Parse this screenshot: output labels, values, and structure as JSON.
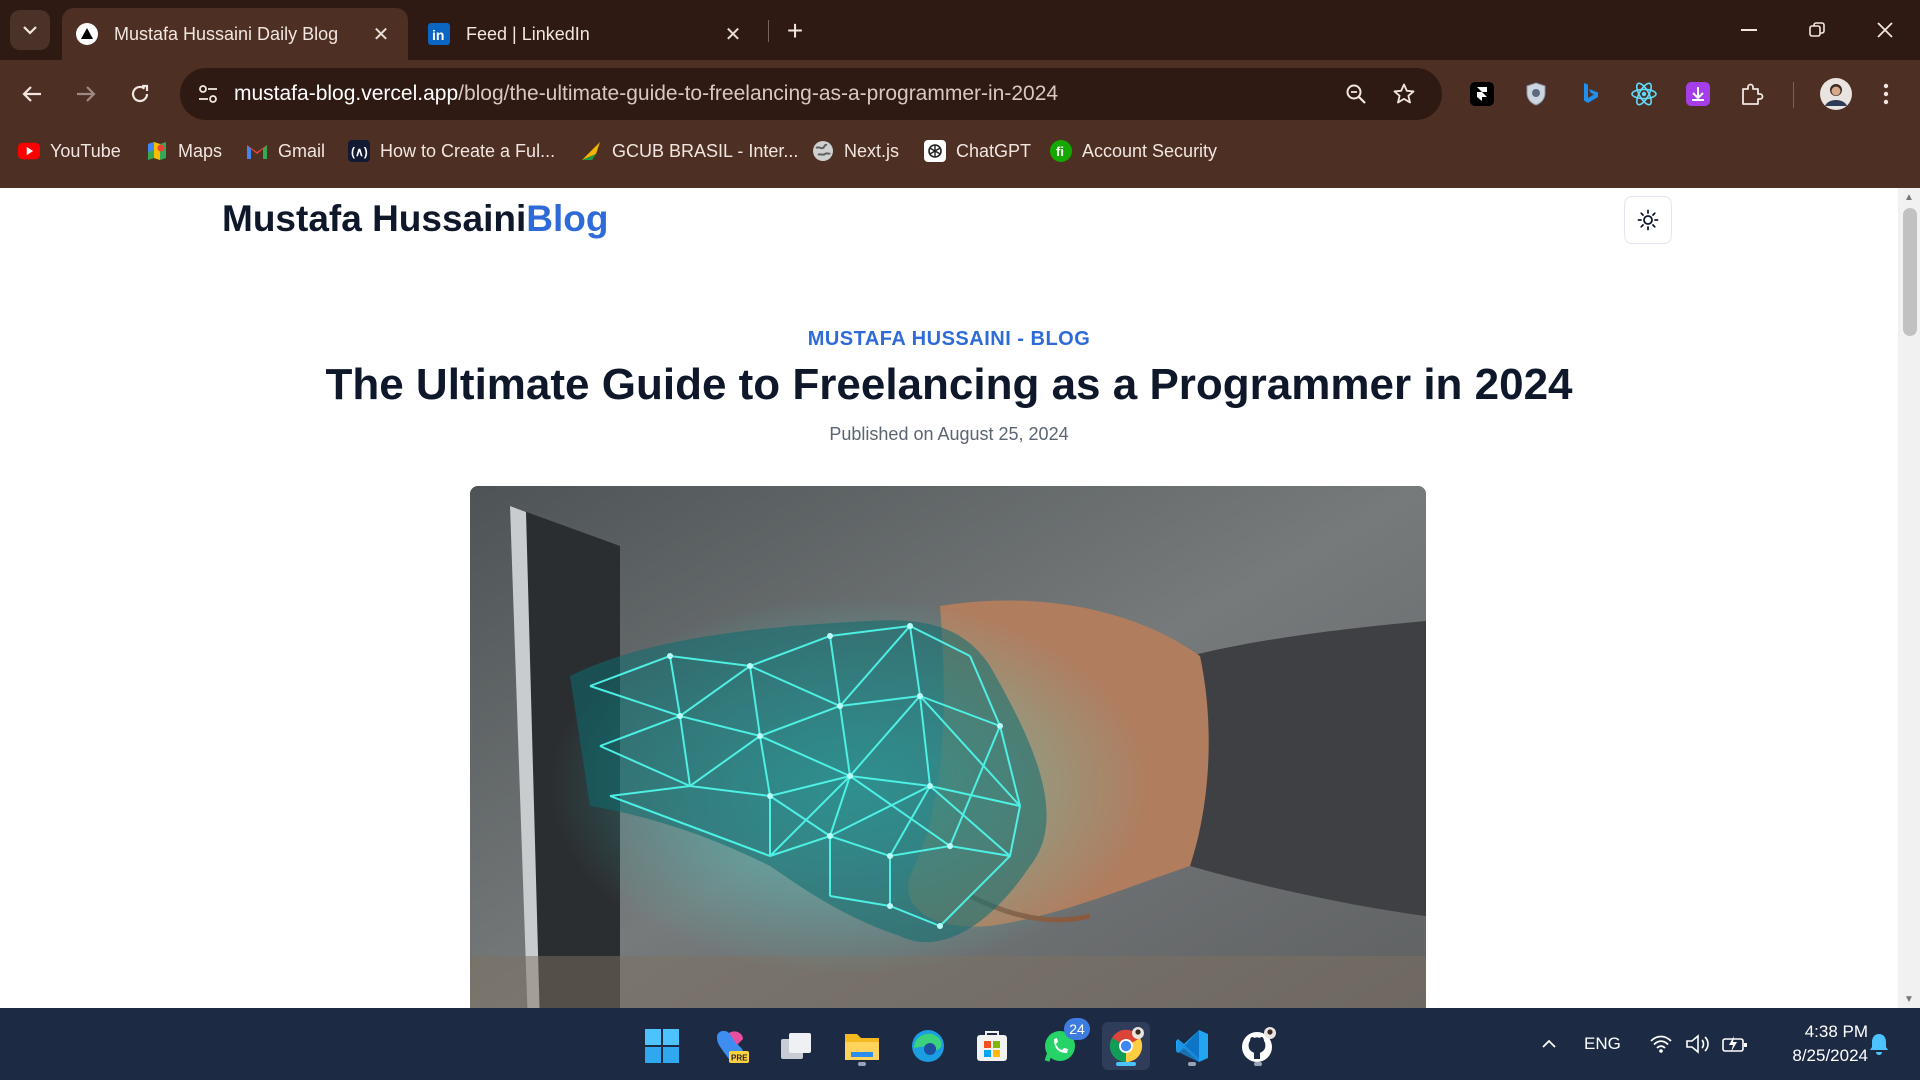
{
  "browser": {
    "tabs": [
      {
        "title": "Mustafa Hussaini Daily Blog",
        "favicon": "vercel-triangle-icon",
        "active": true
      },
      {
        "title": "Feed | LinkedIn",
        "favicon": "linkedin-icon",
        "active": false
      }
    ],
    "url": {
      "host": "mustafa-blog.vercel.app",
      "path": "/blog/the-ultimate-guide-to-freelancing-as-a-programmer-in-2024"
    },
    "bookmarks": [
      {
        "label": "YouTube",
        "icon": "youtube-icon"
      },
      {
        "label": "Maps",
        "icon": "maps-icon"
      },
      {
        "label": "Gmail",
        "icon": "gmail-icon"
      },
      {
        "label": "How to Create a Ful...",
        "icon": "codewithharry-icon"
      },
      {
        "label": "GCUB BRASIL - Inter...",
        "icon": "gcub-icon"
      },
      {
        "label": "Next.js",
        "icon": "globe-icon"
      },
      {
        "label": "ChatGPT",
        "icon": "chatgpt-icon"
      },
      {
        "label": "Account Security",
        "icon": "shield-f-icon"
      }
    ],
    "colors": {
      "tab_strip": "#2e1a12",
      "toolbar": "#4d2f23",
      "omnibox": "#2e1a12"
    }
  },
  "page": {
    "logo_name": "Mustafa Hussaini",
    "logo_accent": "Blog",
    "kicker": "MUSTAFA HUSSAINI - BLOG",
    "title": "The Ultimate Guide to Freelancing as a Programmer in 2024",
    "published": "Published on August 25, 2024",
    "accent_color": "#2f6bd8",
    "hero_image": "laptop-digital-handshake-image"
  },
  "taskbar": {
    "apps": [
      {
        "name": "start",
        "icon": "windows-icon"
      },
      {
        "name": "copilot",
        "icon": "copilot-pre-icon"
      },
      {
        "name": "task-view",
        "icon": "task-view-icon"
      },
      {
        "name": "file-explorer",
        "icon": "folder-icon"
      },
      {
        "name": "edge",
        "icon": "edge-icon"
      },
      {
        "name": "store",
        "icon": "store-icon"
      },
      {
        "name": "whatsapp",
        "icon": "whatsapp-icon",
        "badge": "24"
      },
      {
        "name": "chrome",
        "icon": "chrome-icon",
        "active": true
      },
      {
        "name": "vscode",
        "icon": "vscode-icon"
      },
      {
        "name": "github-desktop",
        "icon": "github-icon"
      }
    ],
    "tray": {
      "language": "ENG",
      "time": "4:38 PM",
      "date": "8/25/2024"
    }
  }
}
